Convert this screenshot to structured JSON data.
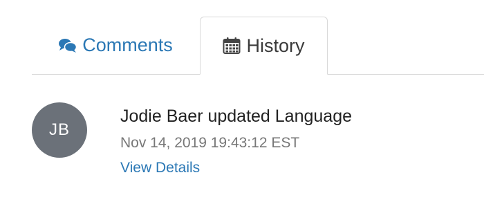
{
  "colors": {
    "link": "#2b78b5",
    "avatar_bg": "#6b7179",
    "tab_border": "#d9d9d9",
    "text_primary": "#222222",
    "text_muted": "#777777"
  },
  "tabs": [
    {
      "label": "Comments",
      "icon": "comments-icon",
      "active": false
    },
    {
      "label": "History",
      "icon": "calendar-icon",
      "active": true
    }
  ],
  "history": {
    "entries": [
      {
        "avatar_initials": "JB",
        "title": "Jodie Baer updated Language",
        "timestamp": "Nov 14, 2019 19:43:12 EST",
        "link_label": "View Details"
      }
    ]
  }
}
